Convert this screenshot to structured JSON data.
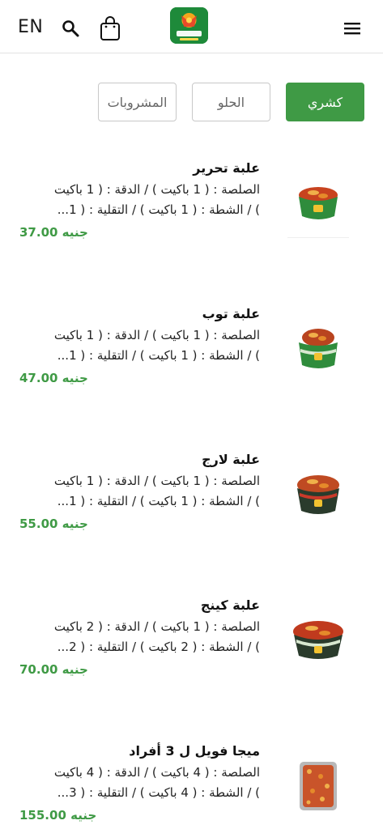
{
  "header": {
    "language_label": "EN",
    "logo_text": "KOSHARY EL TAHRIR"
  },
  "categories": [
    {
      "label": "كشري",
      "active": true
    },
    {
      "label": "الحلو",
      "active": false
    },
    {
      "label": "المشروبات",
      "active": false
    }
  ],
  "products": [
    {
      "name": "علبة تحرير",
      "desc_line1": "الصلصة : ( 1 باكيت ) / الدقة : ( 1 باكيت",
      "desc_line2": ") / الشطة : ( 1 باكيت ) / التقلية : ( 1...",
      "price": "37.00 جنيه"
    },
    {
      "name": "علبة توب",
      "desc_line1": "الصلصة : ( 1 باكيت ) / الدقة : ( 1 باكيت",
      "desc_line2": ") / الشطة : ( 1 باكيت ) / التقلية : ( 1...",
      "price": "47.00 جنيه"
    },
    {
      "name": "علبة لارج",
      "desc_line1": "الصلصة : ( 1 باكيت ) / الدقة : ( 1 باكيت",
      "desc_line2": ") / الشطة : ( 1 باكيت ) / التقلية : ( 1...",
      "price": "55.00 جنيه"
    },
    {
      "name": "علبة كينج",
      "desc_line1": "الصلصة : ( 1 باكيت ) / الدقة : ( 2 باكيت",
      "desc_line2": ") / الشطة : ( 2 باكيت ) / التقلية : ( 2...",
      "price": "70.00 جنيه"
    },
    {
      "name": "ميجا فويل ل 3 أفراد",
      "desc_line1": "الصلصة : ( 4 باكيت ) / الدقة : ( 4 باكيت",
      "desc_line2": ") / الشطة : ( 4 باكيت ) / التقلية : ( 3...",
      "price": "155.00 جنيه"
    }
  ],
  "colors": {
    "accent": "#3f9a45",
    "logo_bg": "#1e8a3a"
  },
  "icons": [
    "search-icon",
    "shopping-bag-icon",
    "hamburger-menu-icon",
    "brand-logo"
  ]
}
